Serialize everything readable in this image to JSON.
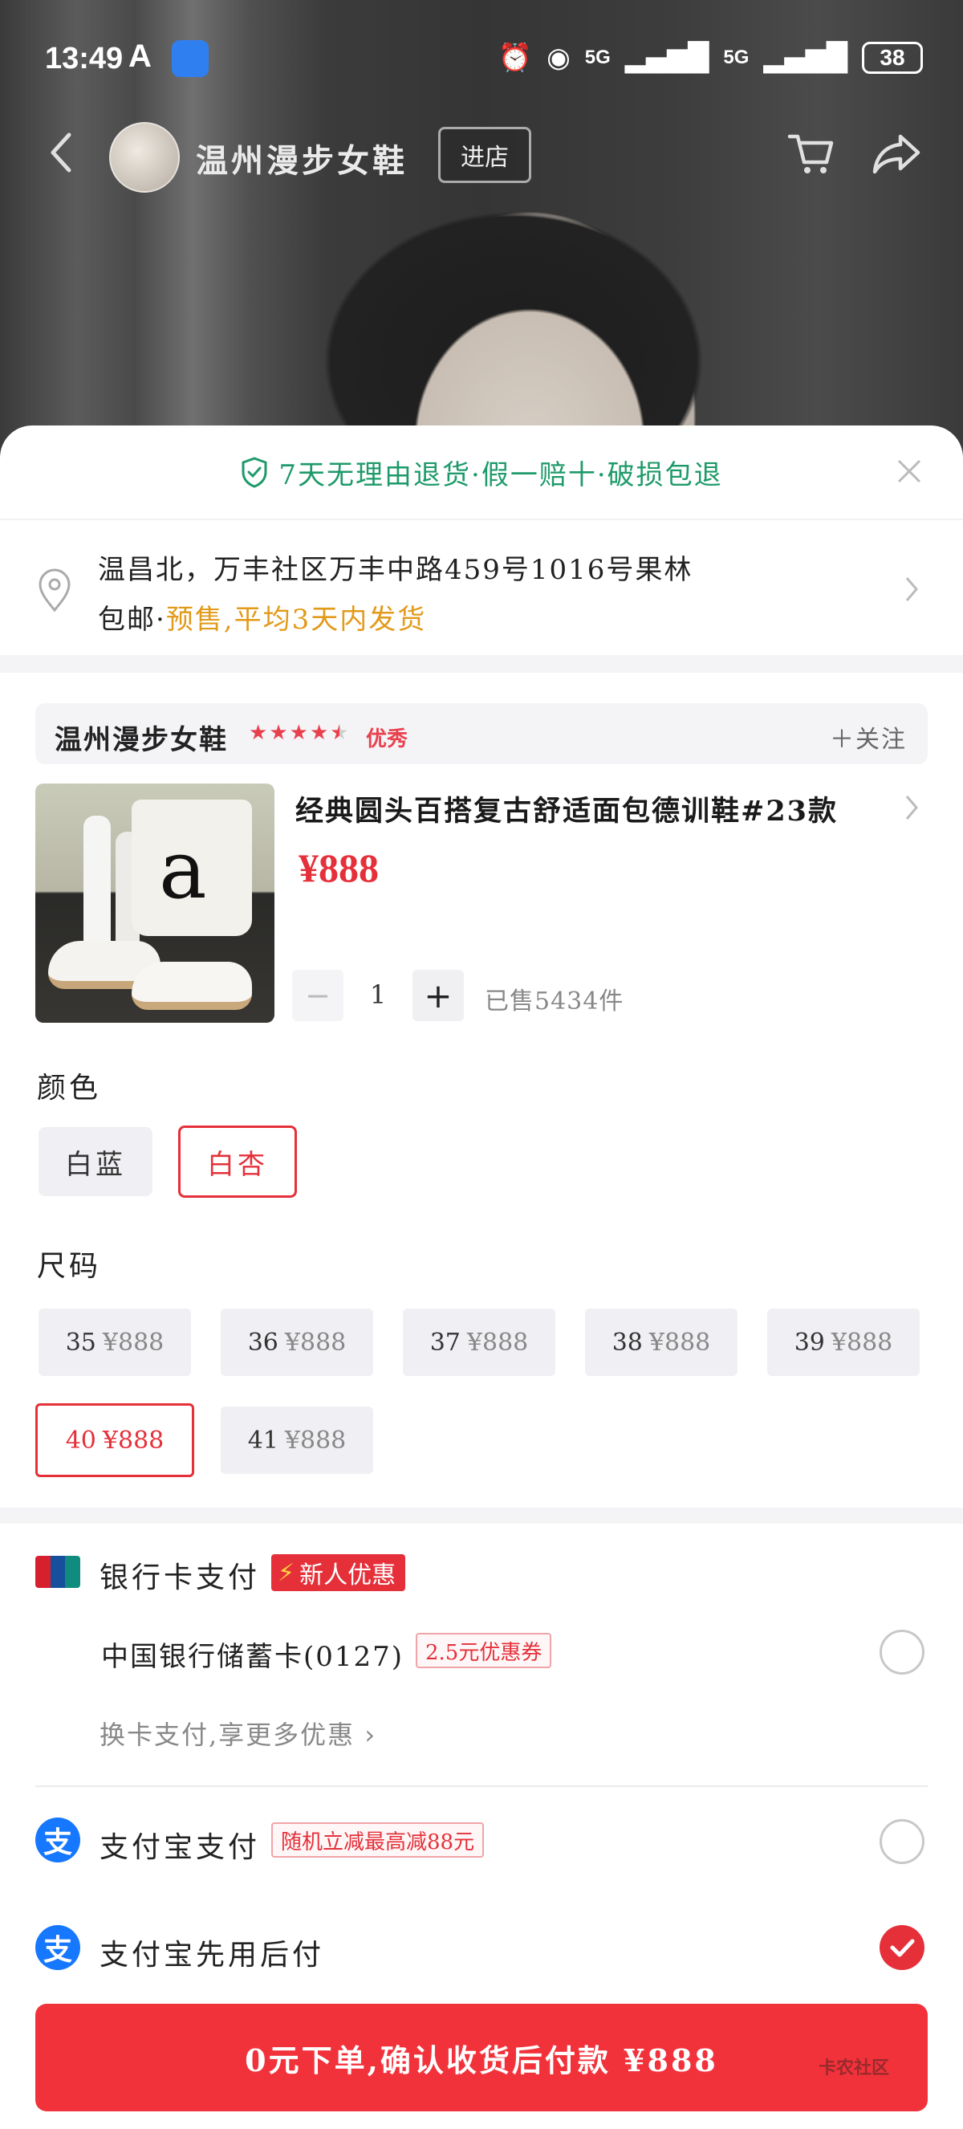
{
  "status_bar": {
    "time": "13:49",
    "a_glyph": "A",
    "network_1": "5G",
    "network_2": "5G",
    "battery": "38"
  },
  "nav": {
    "shop_name": "温州漫步女鞋",
    "enter_shop": "进店"
  },
  "sheet": {
    "guarantee": "7天无理由退货·假一赔十·破损包退",
    "address": {
      "line1": "温昌北，万丰社区万丰中路459号1016号果林",
      "shipping_prefix": "包邮·",
      "presale": "预售,平均3天内发货"
    },
    "shop_bar": {
      "name": "温州漫步女鞋",
      "rating_value": 4.5,
      "rating_label": "优秀",
      "follow": "＋关注"
    },
    "product": {
      "title": "经典圆头百搭复古舒适面包德训鞋#23款",
      "price": "¥888",
      "quantity": "1",
      "sold": "已售5434件"
    },
    "color": {
      "label": "颜色",
      "options": [
        {
          "label": "白蓝",
          "selected": false
        },
        {
          "label": "白杏",
          "selected": true
        }
      ]
    },
    "size": {
      "label": "尺码",
      "options": [
        {
          "size": "35",
          "price": "¥888",
          "selected": false
        },
        {
          "size": "36",
          "price": "¥888",
          "selected": false
        },
        {
          "size": "37",
          "price": "¥888",
          "selected": false
        },
        {
          "size": "38",
          "price": "¥888",
          "selected": false
        },
        {
          "size": "39",
          "price": "¥888",
          "selected": false
        },
        {
          "size": "40",
          "price": "¥888",
          "selected": true
        },
        {
          "size": "41",
          "price": "¥888",
          "selected": false
        }
      ]
    },
    "payment": {
      "bank_title": "银行卡支付",
      "bank_badge": "新人优惠",
      "bank_card": "中国银行储蓄卡(0127)",
      "bank_coupon": "2.5元优惠券",
      "bank_more": "换卡支付,享更多优惠",
      "alipay_title": "支付宝支付",
      "alipay_tag": "随机立减最高减88元",
      "alipay_later_title": "支付宝先用后付",
      "alipay_icon_glyph": "支",
      "selected_method": "alipay_later"
    },
    "cta": "0元下单,确认收货后付款 ¥888",
    "watermark": "卡农社区"
  },
  "colors": {
    "accent_red": "#e5303a",
    "guarantee_green": "#1e9a6a",
    "presale_orange": "#e29a1a",
    "alipay_blue": "#1677ff"
  }
}
